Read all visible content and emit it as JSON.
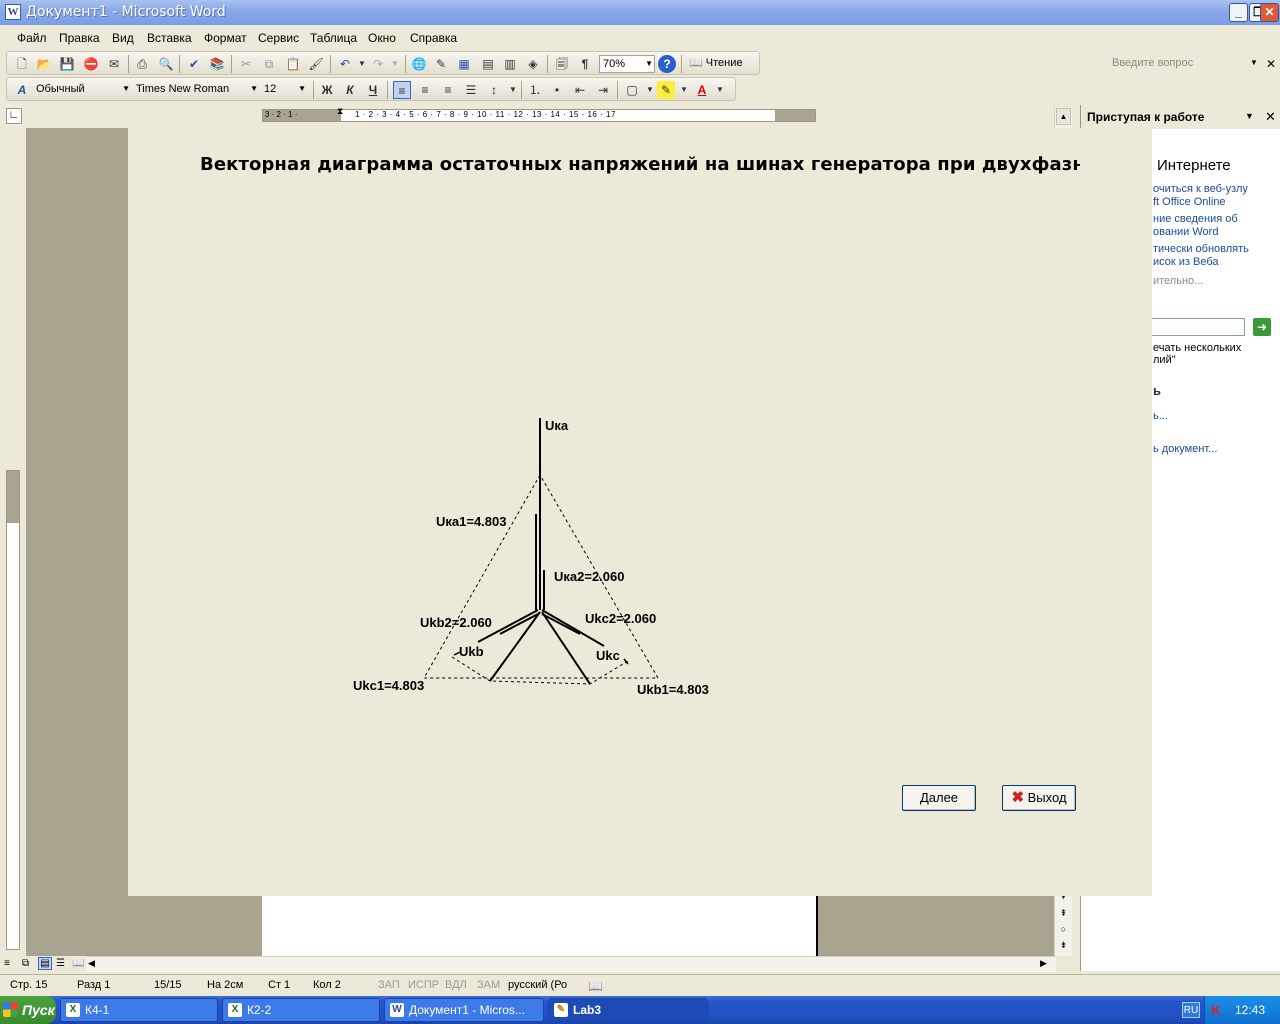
{
  "window": {
    "title": "Документ1 - Microsoft Word",
    "app_icon": "W"
  },
  "menu": [
    "Файл",
    "Правка",
    "Вид",
    "Вставка",
    "Формат",
    "Сервис",
    "Таблица",
    "Окно",
    "Справка"
  ],
  "ask_placeholder": "Введите вопрос",
  "toolbar": {
    "zoom": "70%",
    "reading_label": "Чтение",
    "style": "Обычный",
    "font": "Times New Roman",
    "size": "12",
    "bold": "Ж",
    "italic": "К",
    "underline": "Ч"
  },
  "ruler": {
    "left_marks": "3 · 2 · 1 ·",
    "marks": "1 · 2 · 3 · 4 · 5 · 6 · 7 · 8 · 9 · 10 · 11 · 12 · 13 · 14 · 15 · 16 · 17"
  },
  "dialog": {
    "title": "Векторная диаграмма остаточных напряжений на шинах генератора при двухфазном КЗ",
    "next_button": "Далее",
    "exit_button": "Выход",
    "labels": {
      "uka": "Uка",
      "uka1": "Uка1=4.803",
      "uka2": "Uка2=2.060",
      "ukb2": "Ukb2=2.060",
      "ukc2": "Ukc2=2.060",
      "ukb": "Ukb",
      "ukc": "Ukc",
      "ukc1": "Ukc1=4.803",
      "ukb1": "Ukb1=4.803"
    }
  },
  "taskpane": {
    "title": "Приступая к работе",
    "heading": "Интернете",
    "links": [
      "очиться к веб-узлу",
      "ft Office Online",
      "ние сведения об",
      "овании Word",
      "тически обновлять",
      "исок из Веба"
    ],
    "more": "ительно...",
    "checkbox_text_1": "ечать нескольких",
    "checkbox_text_2": "лий\"",
    "section": "ь",
    "open_link_1": "ь...",
    "open_link_2": "ь документ..."
  },
  "status": {
    "page": "Стр. 15",
    "section": "Разд 1",
    "pages": "15/15",
    "at": "На 2см",
    "line": "Ст 1",
    "col": "Кол 2",
    "rec": "ЗАП",
    "trk": "ИСПР",
    "ext": "ВДЛ",
    "ovr": "ЗАМ",
    "lang": "русский (Ро"
  },
  "taskbar": {
    "start": "Пуск",
    "tasks": [
      "К4-1",
      "К2-2",
      "Документ1 - Micros...",
      "Lab3"
    ],
    "lang": "RU",
    "clock": "12:43"
  },
  "colors": {
    "titlebar": "#7b9de4",
    "dialog_bg": "#ece9d8",
    "doc_gray": "#a8a490",
    "taskbar": "#2456c8",
    "link": "#1c4ba0"
  }
}
